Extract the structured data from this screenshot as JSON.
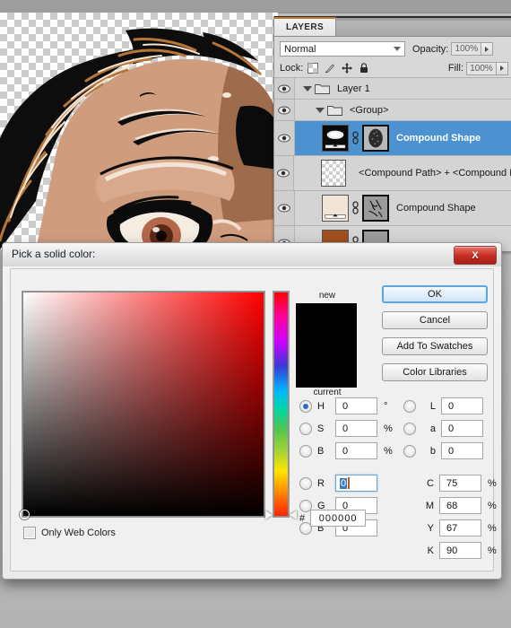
{
  "layers_panel": {
    "tab_label": "LAYERS",
    "blend_mode": "Normal",
    "opacity_label": "Opacity:",
    "opacity_value": "100%",
    "lock_label": "Lock:",
    "fill_label": "Fill:",
    "fill_value": "100%",
    "lock_icons": [
      "lock-transparent-pixels-icon",
      "lock-image-pixels-icon",
      "lock-position-icon",
      "lock-all-icon"
    ],
    "rows": [
      {
        "name": "Layer 1",
        "type": "group",
        "selected": false,
        "indent": 0,
        "eye": true
      },
      {
        "name": "<Group>",
        "type": "group",
        "selected": false,
        "indent": 1,
        "eye": true
      },
      {
        "name": "Compound Shape",
        "type": "shape",
        "selected": true,
        "indent": 2,
        "eye": true
      },
      {
        "name": "<Compound Path> + <Compound Pa",
        "type": "path",
        "selected": false,
        "indent": 2,
        "eye": true
      },
      {
        "name": "Compound Shape",
        "type": "shape",
        "selected": false,
        "indent": 2,
        "eye": true
      },
      {
        "name": "",
        "type": "shape",
        "selected": false,
        "indent": 2,
        "eye": true
      }
    ]
  },
  "dialog": {
    "title": "Pick a solid color:",
    "close_label": "X",
    "new_label": "new",
    "current_label": "current",
    "new_color": "#000000",
    "current_color": "#000000",
    "buttons": [
      {
        "label": "OK",
        "primary": true
      },
      {
        "label": "Cancel",
        "primary": false
      },
      {
        "label": "Add To Swatches",
        "primary": false
      },
      {
        "label": "Color Libraries",
        "primary": false
      }
    ],
    "only_web_colors_label": "Only Web Colors",
    "only_web_colors_checked": false,
    "hsb": [
      {
        "key": "H",
        "value": "0",
        "unit": "°",
        "selected": true
      },
      {
        "key": "S",
        "value": "0",
        "unit": "%",
        "selected": false
      },
      {
        "key": "B",
        "value": "0",
        "unit": "%",
        "selected": false
      }
    ],
    "rgb": [
      {
        "key": "R",
        "value": "0",
        "unit": "",
        "selected": false,
        "focused": true
      },
      {
        "key": "G",
        "value": "0",
        "unit": "",
        "selected": false,
        "focused": false
      },
      {
        "key": "B",
        "value": "0",
        "unit": "",
        "selected": false,
        "focused": false
      }
    ],
    "lab": [
      {
        "key": "L",
        "value": "0",
        "unit": "",
        "selected": false
      },
      {
        "key": "a",
        "value": "0",
        "unit": "",
        "selected": false
      },
      {
        "key": "b",
        "value": "0",
        "unit": "",
        "selected": false
      }
    ],
    "cmyk": [
      {
        "key": "C",
        "value": "75",
        "unit": "%"
      },
      {
        "key": "M",
        "value": "68",
        "unit": "%"
      },
      {
        "key": "Y",
        "value": "67",
        "unit": "%"
      },
      {
        "key": "K",
        "value": "90",
        "unit": "%"
      }
    ],
    "hex_prefix": "#",
    "hex_value": "000000",
    "accent_color": "#4c92d1",
    "hue_top_color": "#ff0000"
  },
  "canvas": {
    "artwork_description": "cartoon-face-forehead-and-eye",
    "skin_color": "#cf9c7e",
    "shadow_color": "#9a674a",
    "hair_highlight": "#b5763a",
    "outline_color": "#000000"
  }
}
